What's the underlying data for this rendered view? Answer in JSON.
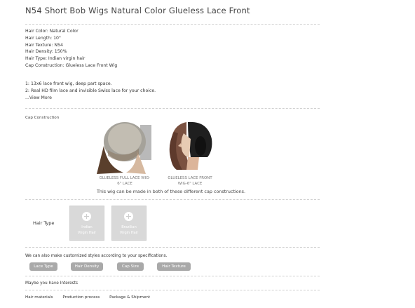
{
  "title": "N54 Short Bob Wigs Natural Color Glueless Lace Front",
  "specs": [
    "Hair Color: Natural Color",
    "Hair Length: 10\"",
    "Hair Texture: N54",
    "Hair Density: 150%",
    "Hair Type: Indian virgin hair",
    "Cap Construction: Glueless Lace Front Wig"
  ],
  "highlights": [
    "1:  13x6 lace front wig, deep part space.",
    "2: Real HD film lace and invisible Swiss lace for your choice."
  ],
  "view_more": "...View More",
  "cap": {
    "heading": "Cap Construction",
    "caption1": "GLUELESS FULL LACE WIG-",
    "caption1b": "6\" LACE",
    "caption2": "GLUELESS LACE FRONT",
    "caption2b": "WIG-6\" LACE",
    "note": "This wig can be made in both of these different cap constructions."
  },
  "hair_type": {
    "label": "Hair Type",
    "options": [
      {
        "line1": "Indian",
        "line2": "Virgin Hair"
      },
      {
        "line1": "Brazilian",
        "line2": "Virgin Hair"
      }
    ]
  },
  "custom": {
    "text": "We can also make customized styles according to your specifications.",
    "buttons": [
      "Lace Type",
      "Hair Density",
      "Cap Size",
      "Hair Texture"
    ]
  },
  "interests": "Maybe you have Interests",
  "tabs": [
    "Hair materials",
    "Production process",
    "Package & Shipment"
  ]
}
